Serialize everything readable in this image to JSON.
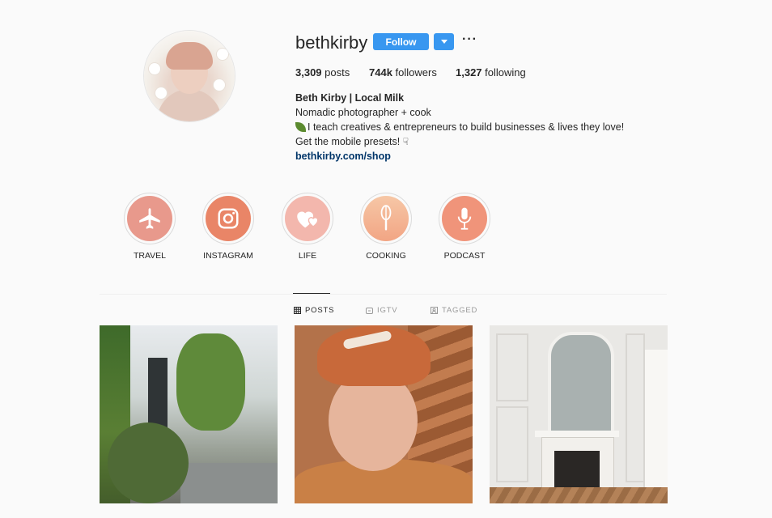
{
  "profile": {
    "username": "bethkirby",
    "follow_label": "Follow",
    "more_label": "···"
  },
  "stats": {
    "posts_count": "3,309",
    "posts_label": "posts",
    "followers_count": "744k",
    "followers_label": "followers",
    "following_count": "1,327",
    "following_label": "following"
  },
  "bio": {
    "name": "Beth Kirby | Local Milk",
    "line1": "Nomadic photographer + cook",
    "line2": "I teach creatives & entrepreneurs to build businesses & lives they love!",
    "line3": "Get the mobile presets!",
    "link": "bethkirby.com/shop"
  },
  "highlights": [
    {
      "label": "TRAVEL",
      "icon": "airplane-icon",
      "color": "#e8998c"
    },
    {
      "label": "INSTAGRAM",
      "icon": "instagram-icon",
      "color": "#e98567"
    },
    {
      "label": "LIFE",
      "icon": "hearts-icon",
      "color": "#f3b7ad"
    },
    {
      "label": "COOKING",
      "icon": "whisk-icon",
      "color": "#f4b496"
    },
    {
      "label": "PODCAST",
      "icon": "microphone-icon",
      "color": "#f0947a"
    }
  ],
  "tabs": [
    {
      "label": "POSTS",
      "icon": "grid-icon",
      "active": true
    },
    {
      "label": "IGTV",
      "icon": "igtv-icon",
      "active": false
    },
    {
      "label": "TAGGED",
      "icon": "tagged-icon",
      "active": false
    }
  ],
  "colors": {
    "accent": "#3897f0",
    "link": "#003569",
    "background": "#fafafa"
  }
}
